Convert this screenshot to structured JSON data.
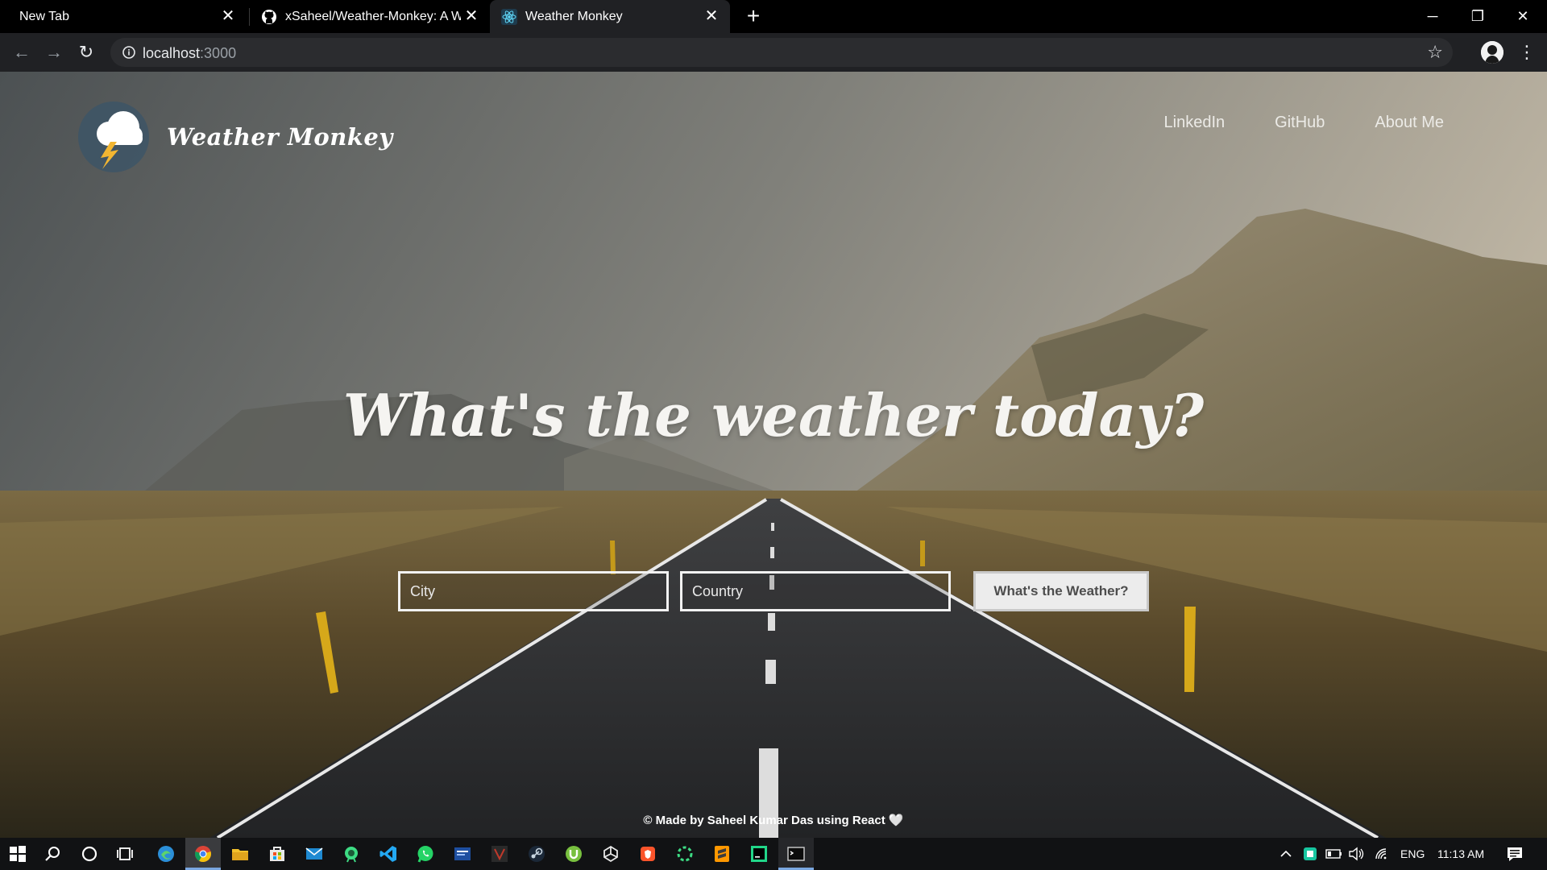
{
  "browser": {
    "tabs": [
      {
        "title": "New Tab",
        "active": false
      },
      {
        "title": "xSaheel/Weather-Monkey: A We",
        "active": false
      },
      {
        "title": "Weather Monkey",
        "active": true
      }
    ],
    "url_host": "localhost",
    "url_port": ":3000"
  },
  "app": {
    "brand_name": "Weather Monkey",
    "nav": [
      "LinkedIn",
      "GitHub",
      "About Me"
    ],
    "hero_title": "What's the weather today?",
    "city_placeholder": "City",
    "country_placeholder": "Country",
    "submit_label": "What's the Weather?",
    "footer": "© Made by Saheel Kumar Das using React 🤍"
  },
  "taskbar": {
    "language": "ENG",
    "time": "11:13 AM"
  },
  "colors": {
    "tabstrip_bg": "#000000",
    "toolbar_bg": "#202124",
    "omnibox_bg": "#2b2c2f",
    "taskbar_bg": "#111214",
    "button_bg": "#ececec"
  }
}
